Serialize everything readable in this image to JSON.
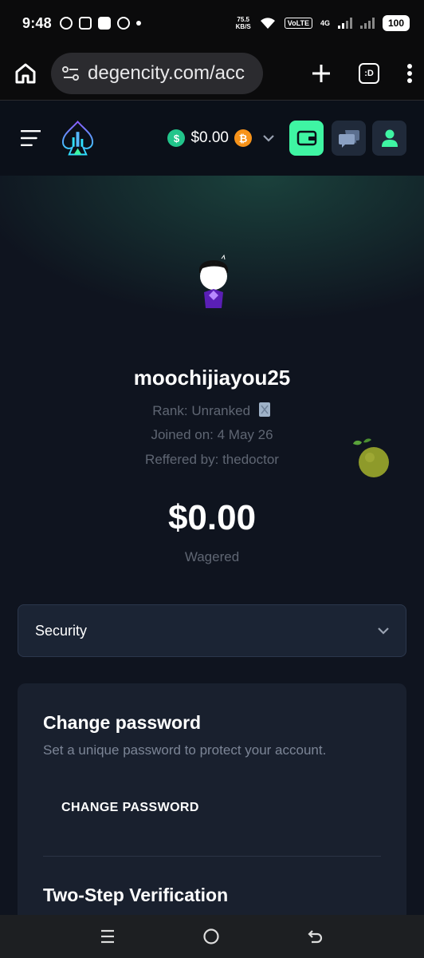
{
  "status_bar": {
    "time": "9:48",
    "speed_value": "75.5",
    "speed_unit": "KB/S",
    "volte": "VoLTE",
    "network": "4G",
    "battery": "100"
  },
  "browser": {
    "url": "degencity.com/acc",
    "tab_switcher_label": ":D"
  },
  "header": {
    "balance": "$0.00",
    "usd_symbol": "$",
    "btc_symbol": "₿"
  },
  "profile": {
    "username": "moochijiayou25",
    "rank": "Rank: Unranked",
    "joined": "Joined on: 4 May 26",
    "referred": "Reffered by: thedoctor",
    "wagered_amount": "$0.00",
    "wagered_label": "Wagered"
  },
  "security_select": {
    "value": "Security"
  },
  "card": {
    "change_password_title": "Change password",
    "change_password_desc": "Set a unique password to protect your account.",
    "change_password_button": "CHANGE PASSWORD",
    "two_step_title": "Two-Step Verification"
  },
  "colors": {
    "accent": "#3ff5a3",
    "background": "#0f141f",
    "card": "#19202e",
    "muted_text": "#5f6673"
  }
}
